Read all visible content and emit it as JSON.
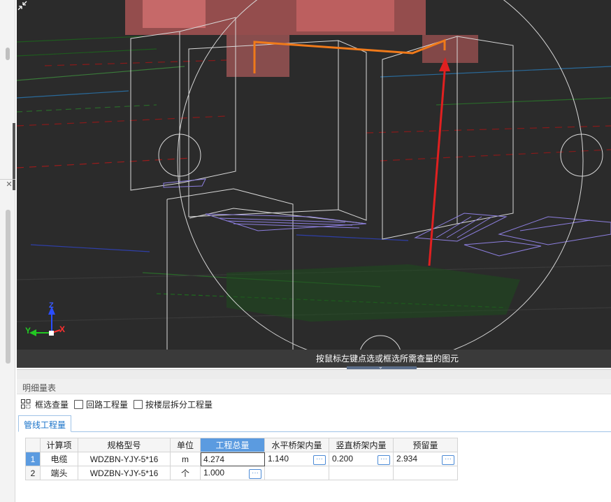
{
  "viewport": {
    "status_text": "按鼠标左键点选或框选所需查量的图元",
    "axes": {
      "x": "X",
      "y": "Y",
      "z": "Z"
    }
  },
  "panel": {
    "title": "明细量表",
    "toolbar": {
      "select_label": "框选查量",
      "checkbox_loop": "回路工程量",
      "checkbox_floor": "按楼层拆分工程量"
    },
    "tab_label": "管线工程量",
    "table": {
      "headers": [
        "计算项",
        "规格型号",
        "单位",
        "工程总量",
        "水平桥架内量",
        "竖直桥架内量",
        "预留量"
      ],
      "rows": [
        {
          "num": "1",
          "item": "电缆",
          "spec": "WDZBN-YJY-5*16",
          "unit": "m",
          "total": "4.274",
          "horiz": "1.140",
          "vert": "0.200",
          "reserve": "2.934"
        },
        {
          "num": "2",
          "item": "端头",
          "spec": "WDZBN-YJY-5*16",
          "unit": "个",
          "total": "1.000",
          "horiz": "",
          "vert": "",
          "reserve": ""
        }
      ]
    },
    "ellipsis_glyph": "···"
  },
  "left_panel": {
    "close_glyph": "✕"
  }
}
